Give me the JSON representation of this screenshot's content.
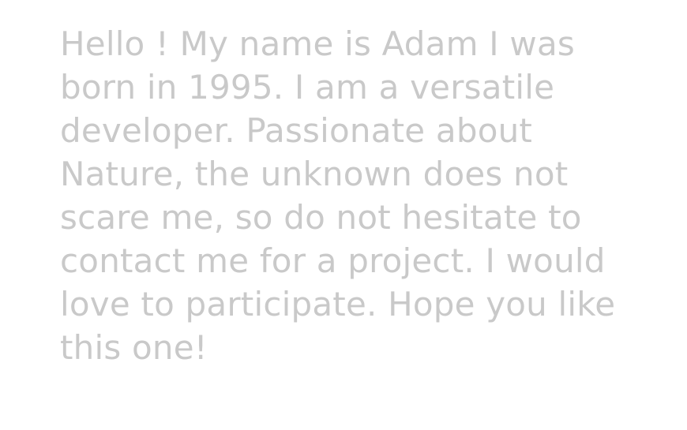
{
  "bio": {
    "lines": [
      "Hello ! My name is Adam I was",
      "born in 1995. I am a versatile",
      "developer. Passionate about",
      "Nature, the unknown does not",
      "scare me, so do not hesitate to",
      "contact me for a project. I would",
      "love to participate. Hope you like",
      "this one!"
    ]
  },
  "theme": {
    "text_color": "#c9c9c9",
    "background": "#ffffff"
  }
}
